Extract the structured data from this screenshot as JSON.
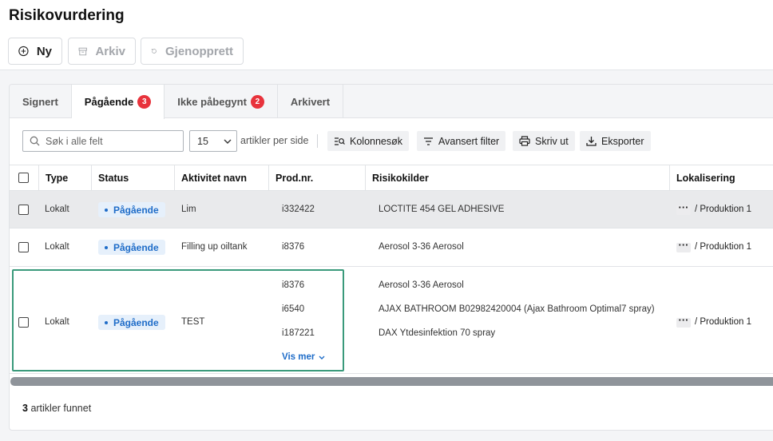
{
  "page": {
    "title": "Risikovurdering"
  },
  "toolbar": {
    "new_label": "Ny",
    "archive_label": "Arkiv",
    "restore_label": "Gjenopprett"
  },
  "tabs": [
    {
      "label": "Signert",
      "badge": ""
    },
    {
      "label": "Pågående",
      "badge": "3"
    },
    {
      "label": "Ikke påbegynt",
      "badge": "2"
    },
    {
      "label": "Arkivert",
      "badge": ""
    }
  ],
  "search": {
    "placeholder": "Søk i alle felt"
  },
  "pagination": {
    "per_page_value": "15",
    "per_page_label": "artikler per side"
  },
  "actions": {
    "column_search": "Kolonnesøk",
    "advanced_filter": "Avansert filter",
    "print": "Skriv ut",
    "export": "Eksporter"
  },
  "table": {
    "headers": [
      "Type",
      "Status",
      "Aktivitet navn",
      "Prod.nr.",
      "Risikokilder",
      "Lokalisering"
    ],
    "rows": [
      {
        "type": "Lokalt",
        "status": "Pågående",
        "activity": "Lim",
        "prod": [
          "i332422"
        ],
        "risk": [
          "LOCTITE 454 GEL ADHESIVE"
        ],
        "location": "Produktion 1"
      },
      {
        "type": "Lokalt",
        "status": "Pågående",
        "activity": "Filling up oiltank",
        "prod": [
          "i8376"
        ],
        "risk": [
          "Aerosol 3-36 Aerosol"
        ],
        "location": "Produktion 1"
      },
      {
        "type": "Lokalt",
        "status": "Pågående",
        "activity": "TEST",
        "prod": [
          "i8376",
          "i6540",
          "i187221"
        ],
        "risk": [
          "Aerosol 3-36 Aerosol",
          "AJAX BATHROOM B02982420004 (Ajax Bathroom Optimal7 spray)",
          "DAX Ytdesinfektion 70 spray"
        ],
        "location": "Produktion 1",
        "show_more": "Vis mer"
      }
    ]
  },
  "footer": {
    "count": "3",
    "label": "artikler funnet"
  },
  "colors": {
    "accent": "#1e6cc8",
    "badge": "#e8333c",
    "highlight_border": "#3a9a7b"
  }
}
